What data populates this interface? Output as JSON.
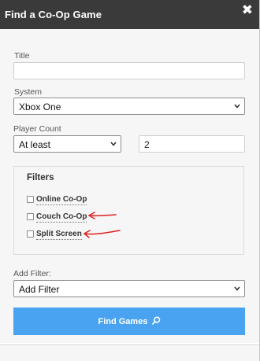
{
  "dialog": {
    "title": "Find a Co-Op Game",
    "close_glyph": "✖"
  },
  "form": {
    "title_label": "Title",
    "title_value": "",
    "system_label": "System",
    "system_value": "Xbox One",
    "player_count_label": "Player Count",
    "player_count_mode": "At least",
    "player_count_value": "2",
    "add_filter_label": "Add Filter:",
    "add_filter_value": "Add Filter"
  },
  "filters": {
    "heading": "Filters",
    "items": [
      {
        "label": "Online Co-Op",
        "checked": false
      },
      {
        "label": "Couch Co-Op",
        "checked": false
      },
      {
        "label": "Split Screen",
        "checked": false
      }
    ]
  },
  "actions": {
    "find_label": "Find Games",
    "find_icon": "search-icon"
  },
  "colors": {
    "titlebar": "#3a3a3a",
    "button": "#4aa3f0",
    "annotation": "#e02020"
  }
}
